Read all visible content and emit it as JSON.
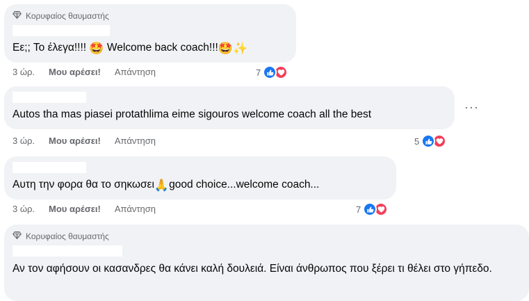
{
  "comments": [
    {
      "badge": "Κορυφαίος θαυμαστής",
      "text_before": "Εε;; Το έλεγα!!!! ",
      "text_middle": " Welcome back coach!!!",
      "emoji_a": "🤩",
      "emoji_b": "🤩",
      "emoji_c": "✨",
      "time": "3 ώρ.",
      "like_label": "Μου αρέσει!",
      "reply_label": "Απάντηση",
      "reaction_count": "7"
    },
    {
      "text": "Autos tha mas piasei protathlima eime sigouros welcome coach all the best",
      "time": "3 ώρ.",
      "like_label": "Μου αρέσει!",
      "reply_label": "Απάντηση",
      "reaction_count": "5",
      "more_label": "···"
    },
    {
      "text_before": "Αυτη την φορα θα το σηκωσει",
      "emoji": "🙏",
      "text_after": "good choice...welcome coach...",
      "time": "3 ώρ.",
      "like_label": "Μου αρέσει!",
      "reply_label": "Απάντηση",
      "reaction_count": "7"
    },
    {
      "badge": "Κορυφαίος θαυμαστής",
      "text": "Αν τον αφήσουν οι κασανδρες θα κάνει καλή δουλειά. Είναι άνθρωπος που ξέρει τι θέλει στο γήπεδο."
    }
  ],
  "icons": {
    "badge": "diamond-icon",
    "like": "thumbs-up-icon",
    "love": "heart-icon",
    "more": "more-options-icon"
  },
  "colors": {
    "bubble": "#f0f2f5",
    "secondary_text": "#65676b",
    "like_blue": "#1877f2",
    "love_red": "#f33e58"
  }
}
